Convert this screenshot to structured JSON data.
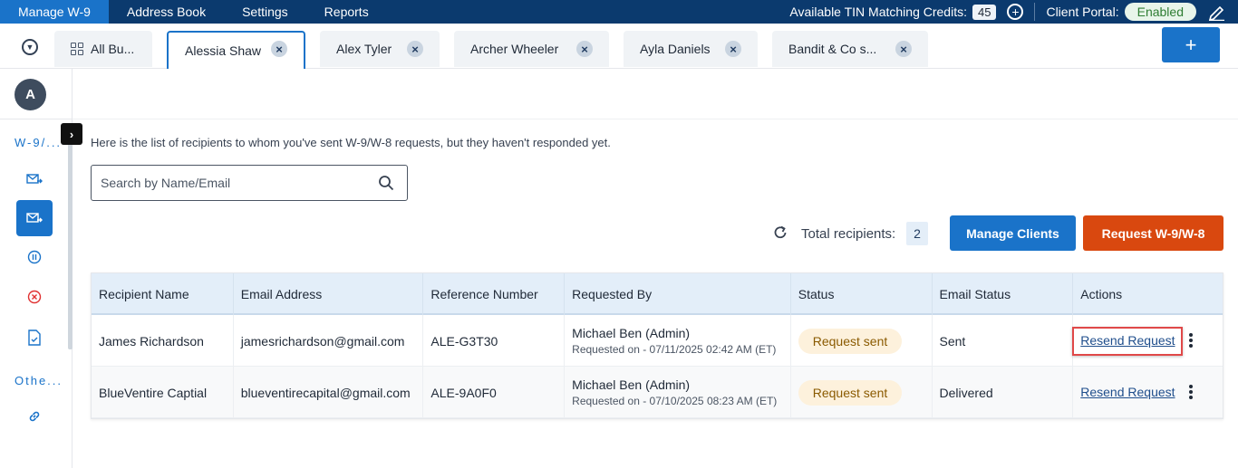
{
  "topnav": {
    "items": [
      "Manage W-9",
      "Address Book",
      "Settings",
      "Reports"
    ],
    "credits_label": "Available TIN Matching Credits:",
    "credits_value": "45",
    "portal_label": "Client Portal:",
    "portal_status": "Enabled"
  },
  "tabs": [
    {
      "label": "All Bu..."
    },
    {
      "label": "Alessia Shaw"
    },
    {
      "label": "Alex Tyler"
    },
    {
      "label": "Archer Wheeler"
    },
    {
      "label": "Ayla Daniels"
    },
    {
      "label": "Bandit & Co s..."
    }
  ],
  "add_tab_label": "+",
  "sidebar": {
    "avatar": "A",
    "expand_icon": "chevron-right-icon",
    "section1": "W-9/...",
    "section2": "Othe...",
    "icons": [
      "mail-send-icon",
      "mail-open-icon",
      "pause-icon",
      "cancel-icon",
      "document-icon",
      "link-icon"
    ]
  },
  "main": {
    "intro": "Here is the list of recipients to whom you've sent W-9/W-8 requests, but they haven't responded yet.",
    "search_placeholder": "Search by Name/Email",
    "total_label": "Total recipients:",
    "total_value": "2",
    "manage_clients_label": "Manage Clients",
    "request_label": "Request W-9/W-8"
  },
  "table": {
    "headers": [
      "Recipient Name",
      "Email Address",
      "Reference Number",
      "Requested By",
      "Status",
      "Email Status",
      "Actions"
    ],
    "rows": [
      {
        "name": "James Richardson",
        "email": "jamesrichardson@gmail.com",
        "ref": "ALE-G3T30",
        "requested_by": "Michael Ben (Admin)",
        "requested_on": "Requested on - 07/11/2025 02:42 AM (ET)",
        "status": "Request sent",
        "email_status": "Sent",
        "action": "Resend Request"
      },
      {
        "name": "BlueVentire Captial",
        "email": "blueventirecapital@gmail.com",
        "ref": "ALE-9A0F0",
        "requested_by": "Michael Ben (Admin)",
        "requested_on": "Requested on - 07/10/2025 08:23 AM (ET)",
        "status": "Request sent",
        "email_status": "Delivered",
        "action": "Resend Request"
      }
    ]
  },
  "colors": {
    "nav_bg": "#0b3a6e",
    "accent": "#1a73c9",
    "request_btn": "#d9480f",
    "highlight": "#e04848"
  }
}
